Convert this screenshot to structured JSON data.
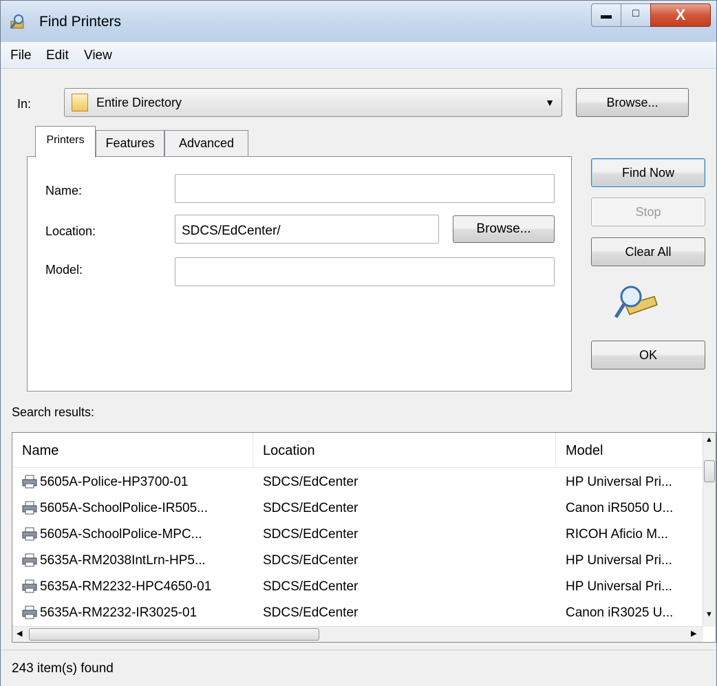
{
  "window": {
    "title": "Find Printers",
    "title_icon": "find-printer-icon"
  },
  "menu": [
    "File",
    "Edit",
    "View"
  ],
  "in_row": {
    "label": "In:",
    "value": "Entire Directory",
    "browse_label": "Browse..."
  },
  "tabs": [
    "Printers",
    "Features",
    "Advanced"
  ],
  "form": {
    "name_label": "Name:",
    "name_value": "",
    "location_label": "Location:",
    "location_value": "SDCS/EdCenter/",
    "location_browse": "Browse...",
    "model_label": "Model:",
    "model_value": ""
  },
  "actions": {
    "find_now": "Find Now",
    "stop": "Stop",
    "clear_all": "Clear All",
    "ok": "OK"
  },
  "results_label": "Search results:",
  "columns": [
    "Name",
    "Location",
    "Model"
  ],
  "rows": [
    {
      "name": "5605A-Police-HP3700-01",
      "location": "SDCS/EdCenter",
      "model": "HP Universal Pri..."
    },
    {
      "name": "5605A-SchoolPolice-IR505...",
      "location": "SDCS/EdCenter",
      "model": "Canon iR5050 U..."
    },
    {
      "name": "5605A-SchoolPolice-MPC...",
      "location": "SDCS/EdCenter",
      "model": "RICOH Aficio M..."
    },
    {
      "name": "5635A-RM2038IntLrn-HP5...",
      "location": "SDCS/EdCenter",
      "model": "HP Universal Pri..."
    },
    {
      "name": "5635A-RM2232-HPC4650-01",
      "location": "SDCS/EdCenter",
      "model": "HP Universal Pri..."
    },
    {
      "name": "5635A-RM2232-IR3025-01",
      "location": "SDCS/EdCenter",
      "model": "Canon iR3025 U..."
    }
  ],
  "status": "243 item(s) found"
}
